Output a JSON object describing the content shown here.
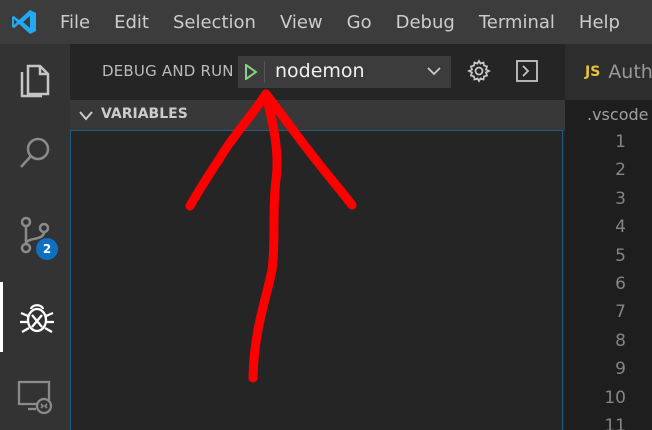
{
  "menu": {
    "items": [
      "File",
      "Edit",
      "Selection",
      "View",
      "Go",
      "Debug",
      "Terminal",
      "Help"
    ]
  },
  "activity": {
    "scm_badge": "2"
  },
  "debug": {
    "title": "DEBUG AND RUN",
    "configuration": "nodemon"
  },
  "variables": {
    "title": "VARIABLES"
  },
  "editor": {
    "tab_icon": "JS",
    "tab_label": "Auth",
    "breadcrumb": ".vscode",
    "line_numbers": [
      "1",
      "2",
      "3",
      "4",
      "5",
      "6",
      "7",
      "8",
      "9",
      "10",
      "11"
    ]
  },
  "colors": {
    "accent_blue": "#0e70c0",
    "play_green": "#89d185",
    "annotation_red": "#ff0000"
  }
}
